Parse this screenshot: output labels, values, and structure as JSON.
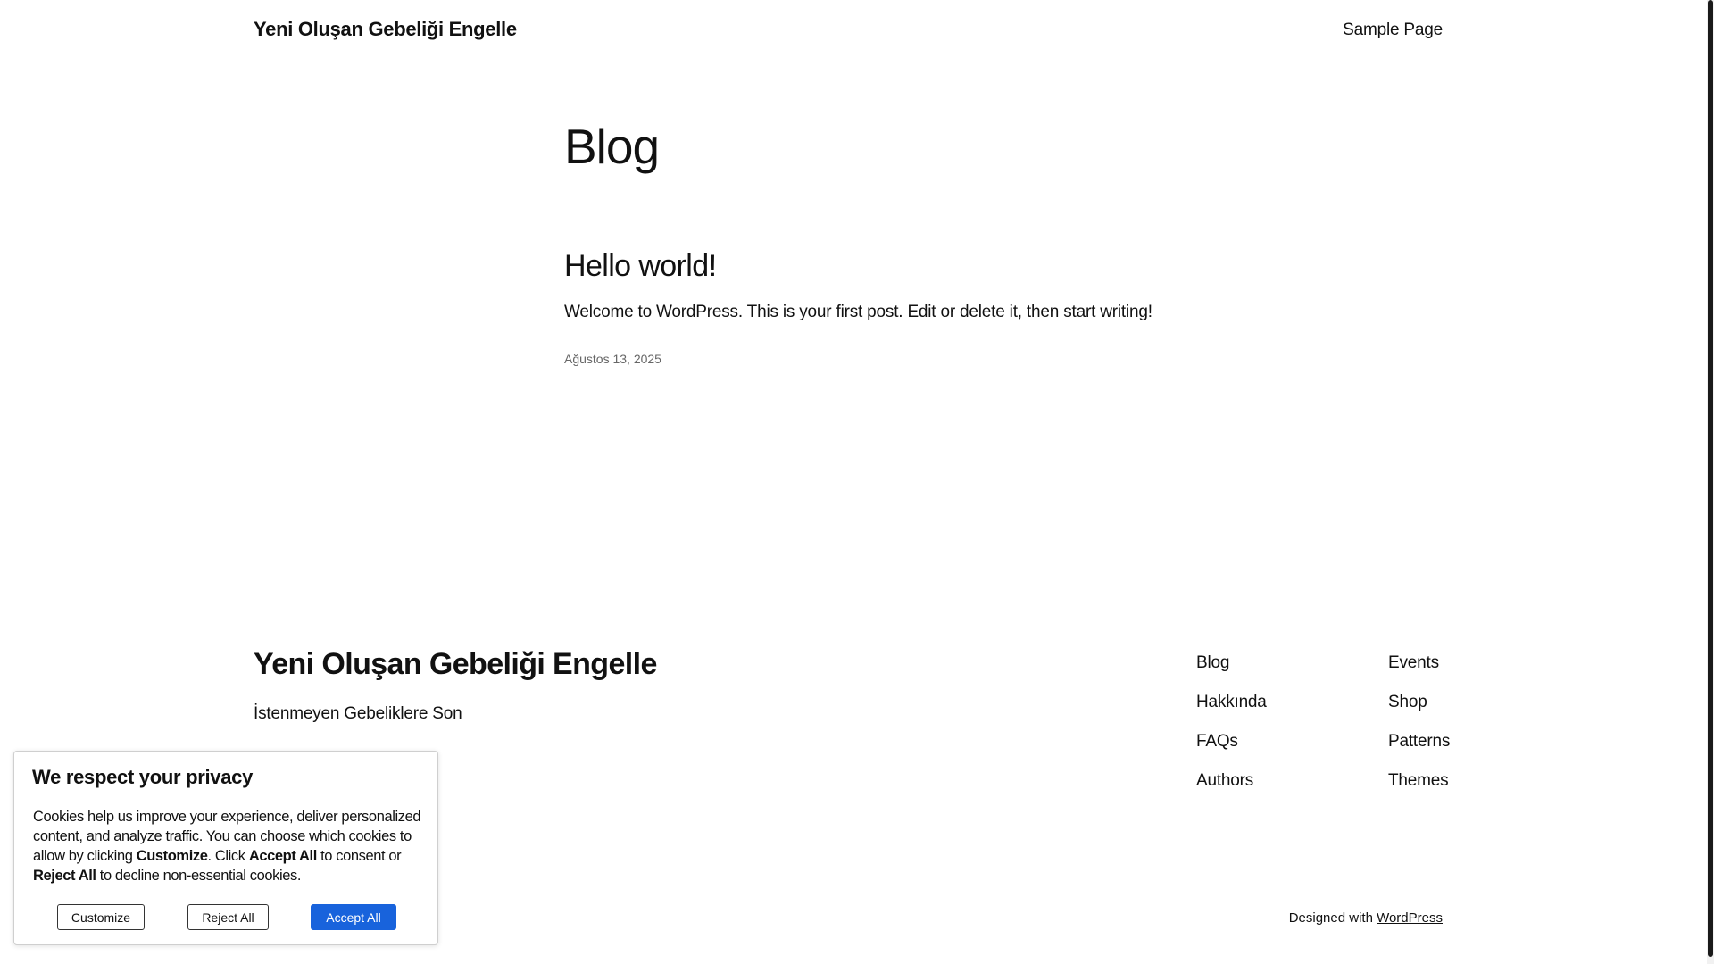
{
  "header": {
    "site_title": "Yeni Oluşan Gebeliği Engelle",
    "nav_link": "Sample Page"
  },
  "main": {
    "page_title": "Blog",
    "post": {
      "title": "Hello world!",
      "excerpt": "Welcome to WordPress. This is your first post. Edit or delete it, then start writing!",
      "date": "Ağustos 13, 2025"
    }
  },
  "footer": {
    "site_title": "Yeni Oluşan Gebeliği Engelle",
    "tagline": "İstenmeyen Gebeliklere Son",
    "links_col1": [
      "Blog",
      "Hakkında",
      "FAQs",
      "Authors"
    ],
    "links_col2": [
      "Events",
      "Shop",
      "Patterns",
      "Themes"
    ],
    "credit_prefix": "Designed with",
    "credit_link": "WordPress"
  },
  "cookie_banner": {
    "title": "We respect your privacy",
    "text_1": "Cookies help us improve your experience, deliver personalized content, and analyze traffic. You can choose which cookies to allow by clicking ",
    "bold_customize": "Customize",
    "text_2": ". Click ",
    "bold_accept": "Accept All",
    "text_3": " to consent or ",
    "bold_reject": "Reject All",
    "text_4": " to decline non-essential cookies.",
    "customize_label": "Customize",
    "reject_label": "Reject All",
    "accept_label": "Accept All",
    "accept_color": "#1863dc"
  }
}
